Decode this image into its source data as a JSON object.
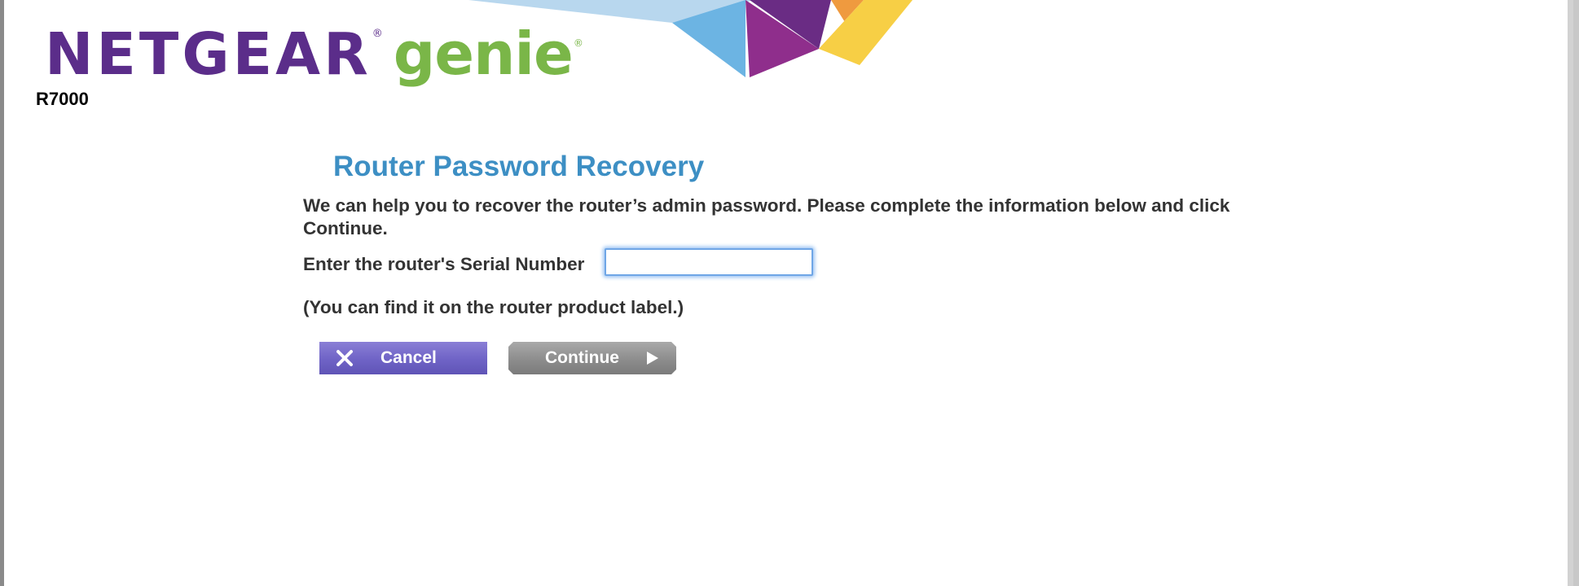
{
  "header": {
    "brand_name": "NETGEAR",
    "brand_product": "genie",
    "registered_mark": "®",
    "model": "R7000"
  },
  "main": {
    "title": "Router Password Recovery",
    "intro": "We can help you to recover the router’s admin password. Please complete the information below and click Continue.",
    "serial_label": "Enter the router's Serial Number",
    "serial_value": "",
    "hint": "(You can find it on the router product label.)"
  },
  "buttons": {
    "cancel_label": "Cancel",
    "continue_label": "Continue"
  },
  "icons": {
    "cancel": "close-icon",
    "continue": "play-arrow-icon"
  },
  "colors": {
    "brand_purple": "#5b2d8a",
    "brand_green": "#7ab648",
    "title_blue": "#3d8fc4",
    "text_dark": "#333333",
    "cancel_button": "#6f63c6",
    "continue_button": "#8d8d8d",
    "input_focus": "#6fa6e6"
  }
}
